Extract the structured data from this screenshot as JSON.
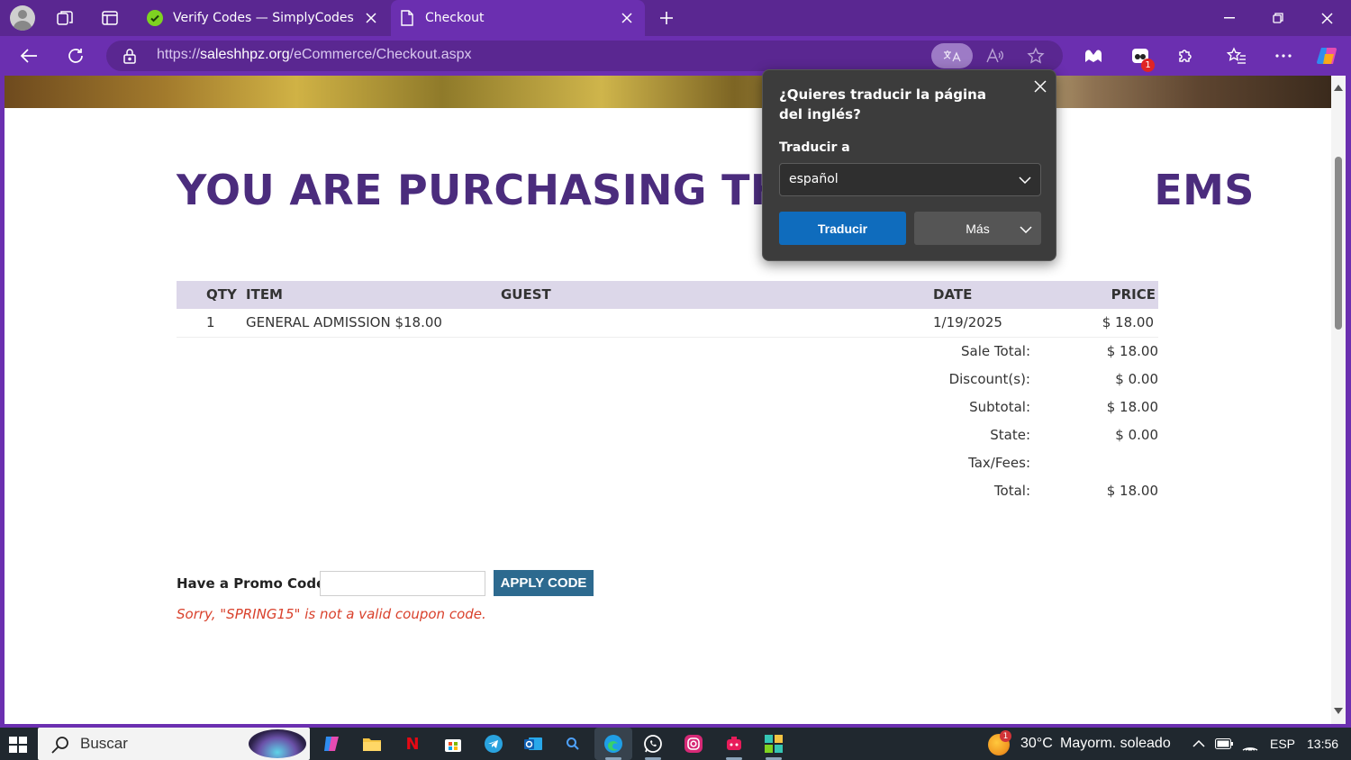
{
  "browser": {
    "tabs": [
      {
        "title": "Verify Codes — SimplyCodes",
        "active": false
      },
      {
        "title": "Checkout",
        "active": true
      }
    ],
    "url_scheme": "https://",
    "url_host": "saleshhpz.org",
    "url_path": "/eCommerce/Checkout.aspx",
    "extension_badge": "1",
    "accent_color": "#6b2fb0"
  },
  "page": {
    "heading_visible_left": "YOU ARE PURCHASING THE F",
    "heading_visible_right": "EMS",
    "table": {
      "headers": {
        "qty": "QTY",
        "item": "ITEM",
        "guest": "GUEST",
        "date": "DATE",
        "price": "PRICE"
      },
      "rows": [
        {
          "qty": "1",
          "item": "GENERAL ADMISSION $18.00",
          "guest": "",
          "date": "1/19/2025",
          "price": "$ 18.00"
        }
      ]
    },
    "summary": [
      {
        "label": "Sale Total:",
        "value": "$ 18.00"
      },
      {
        "label": "Discount(s):",
        "value": "$ 0.00"
      },
      {
        "label": "Subtotal:",
        "value": "$ 18.00"
      },
      {
        "label": "State:",
        "value": "$ 0.00"
      },
      {
        "label": "Tax/Fees:",
        "value": ""
      },
      {
        "label": "Total:",
        "value": "$ 18.00"
      }
    ],
    "promo": {
      "label": "Have a Promo Code?",
      "input_value": "",
      "button": "APPLY CODE",
      "error": "Sorry, \"SPRING15\" is not a valid coupon code."
    }
  },
  "translate_popup": {
    "title": "¿Quieres traducir la página del inglés?",
    "subtitle": "Traducir a",
    "selected_language": "español",
    "translate_button": "Traducir",
    "more_button": "Más"
  },
  "taskbar": {
    "search_placeholder": "Buscar",
    "weather_badge": "1",
    "temperature": "30°C",
    "weather": "Mayorm. soleado",
    "language": "ESP",
    "time": "13:56"
  }
}
